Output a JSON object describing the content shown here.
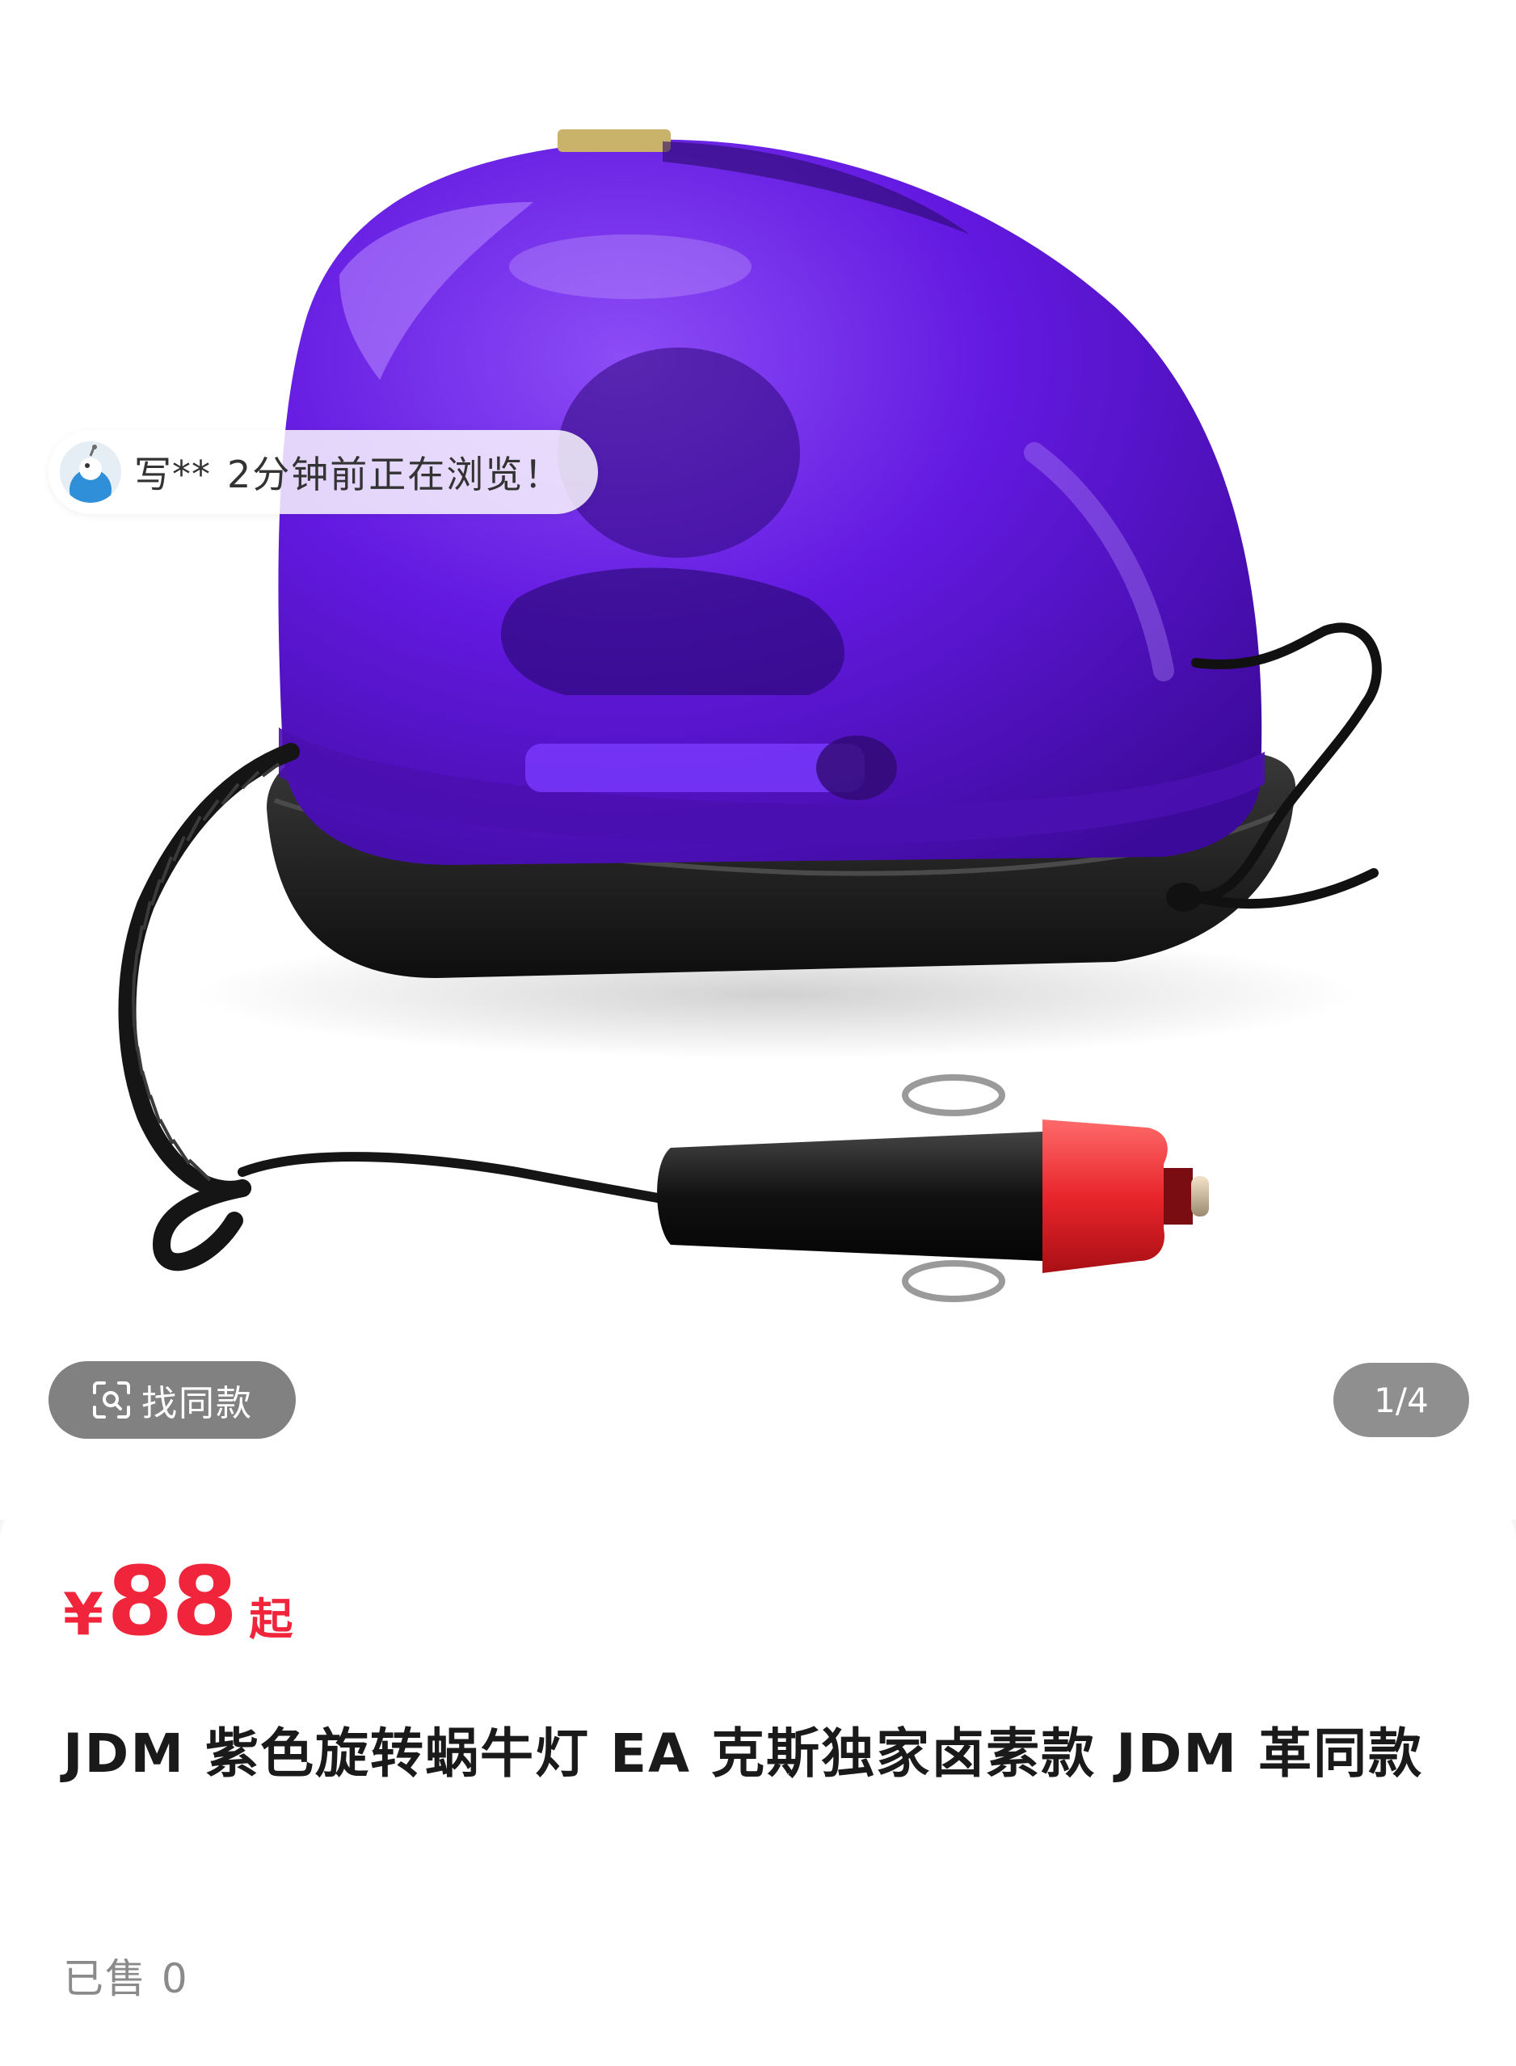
{
  "gallery": {
    "browse_notice": {
      "user": "写**",
      "text": "2分钟前正在浏览！"
    },
    "find_similar_label": "找同款",
    "counter": "1/4",
    "current_image": 1,
    "total_images": 4
  },
  "product": {
    "price_symbol": "¥",
    "price": "88",
    "price_suffix": "起",
    "title": "JDM 紫色旋转蜗牛灯 EA 克斯独家卤素款 JDM 革同款",
    "sold": "已售 0"
  },
  "colors": {
    "accent_price": "#f0243a",
    "lamp_dome": "#5a12d6",
    "plug_tip": "#e8262c"
  },
  "icons": {
    "find_similar": "scan-search-icon",
    "avatar": "user-avatar"
  }
}
